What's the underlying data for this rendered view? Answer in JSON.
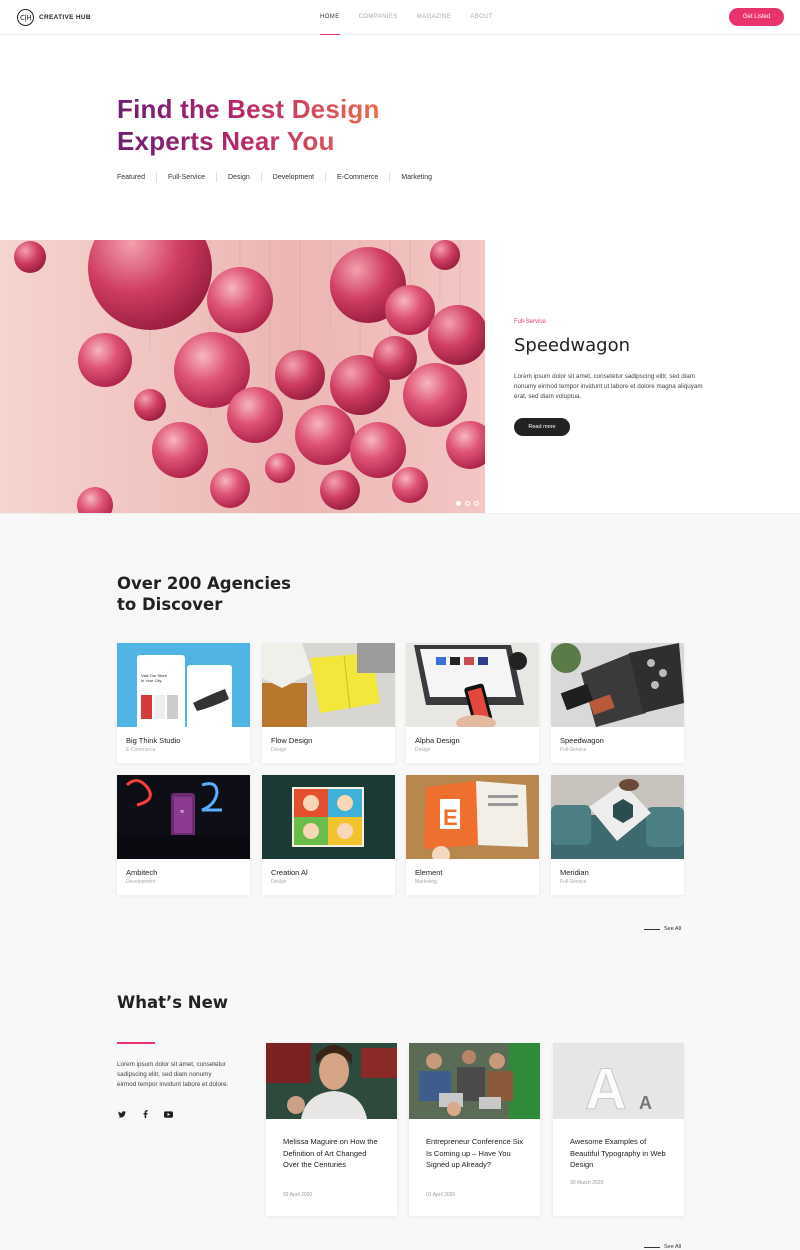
{
  "header": {
    "logo_mark": "C|H",
    "logo_text": "CREATIVE HUB",
    "nav": [
      "HOME",
      "COMPANIES",
      "MAGAZINE",
      "ABOUT"
    ],
    "cta": "Get Listed",
    "accent_color": "#e8336d"
  },
  "hero": {
    "title_line1": "Find the Best Design",
    "title_line2": "Experts Near You",
    "filters": [
      "Featured",
      "Full-Service",
      "Design",
      "Development",
      "E-Commerce",
      "Marketing"
    ]
  },
  "banner": {
    "category": "Full-Service",
    "title": "Speedwagon",
    "description": "Lorem ipsum dolor sit amet, consetetur sadipscing elitr, sed diam nonumy eirmod tempor invidunt ut labore et dolore magna aliquyam erat, sed diam voluptua.",
    "button": "Read more",
    "slides": 3,
    "active_slide": 1
  },
  "agencies": {
    "title_line1": "Over 200 Agencies",
    "title_line2": "to Discover",
    "items": [
      {
        "name": "Big Think Studio",
        "category": "E-Commerce"
      },
      {
        "name": "Flow Design",
        "category": "Design"
      },
      {
        "name": "Alpha Design",
        "category": "Design"
      },
      {
        "name": "Speedwagon",
        "category": "Full-Service"
      },
      {
        "name": "Ambitech",
        "category": "Development"
      },
      {
        "name": "Creation Al",
        "category": "Design"
      },
      {
        "name": "Element",
        "category": "Marketing"
      },
      {
        "name": "Meridian",
        "category": "Full-Service"
      }
    ],
    "see_all": "See All",
    "card_image_text": {
      "shop_title": "Visit Our Store In Your City",
      "letter": "E"
    }
  },
  "news": {
    "title": "What’s New",
    "description": "Lorem ipsum dolor sit amet, consetetur sadipscing elitr, sed diam nonumy eirmod tempor invidunt labore et dolore.",
    "socials": [
      "twitter-icon",
      "facebook-icon",
      "youtube-icon"
    ],
    "articles": [
      {
        "title": "Melissa Maguire on How the Definition of Art Changed Over the Centuries",
        "date": "02 April 2020"
      },
      {
        "title": "Entrepreneur Conference Six Is Coming up – Have You Signed up Already?",
        "date": "01 April 2020"
      },
      {
        "title": "Awesome Examples of Beautiful Typography in Web Design",
        "date": "30 March 2020"
      }
    ],
    "typography_glyphs": [
      "A",
      "A"
    ],
    "see_all": "See All"
  }
}
